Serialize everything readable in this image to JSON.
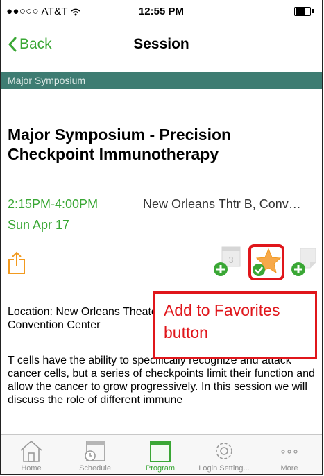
{
  "status_bar": {
    "carrier": "●●○○○ AT&T",
    "time": "12:55 PM"
  },
  "nav": {
    "back_label": "Back",
    "title": "Session"
  },
  "track": "Major Symposium",
  "session": {
    "title": "Major Symposium - Precision Checkpoint Immunotherapy",
    "time": "2:15PM-4:00PM",
    "location": "New Orleans Thtr B, Conv…",
    "date": "Sun Apr 17"
  },
  "actions": {
    "calendar_day": "3"
  },
  "detail": {
    "location_text": "Location: New Orleans Theater B, Ernest N. Morial Convention Center",
    "description": "T cells have the ability to specifically recognize and attack cancer cells, but a series of checkpoints limit their function and allow the cancer to grow progressively. In this session we will discuss the role of different immune"
  },
  "annotation": {
    "label": "Add to Favorites button"
  },
  "tabs": [
    {
      "label": "Home",
      "icon": "home-icon"
    },
    {
      "label": "Schedule",
      "icon": "schedule-icon"
    },
    {
      "label": "Program",
      "icon": "program-icon",
      "active": true
    },
    {
      "label": "Login Setting...",
      "icon": "settings-icon"
    },
    {
      "label": "More",
      "icon": "more-icon"
    }
  ],
  "colors": {
    "accent_green": "#3aa735",
    "track_bar": "#3e7c72",
    "share_orange": "#f29a1f",
    "annotation_red": "#e0161b"
  }
}
